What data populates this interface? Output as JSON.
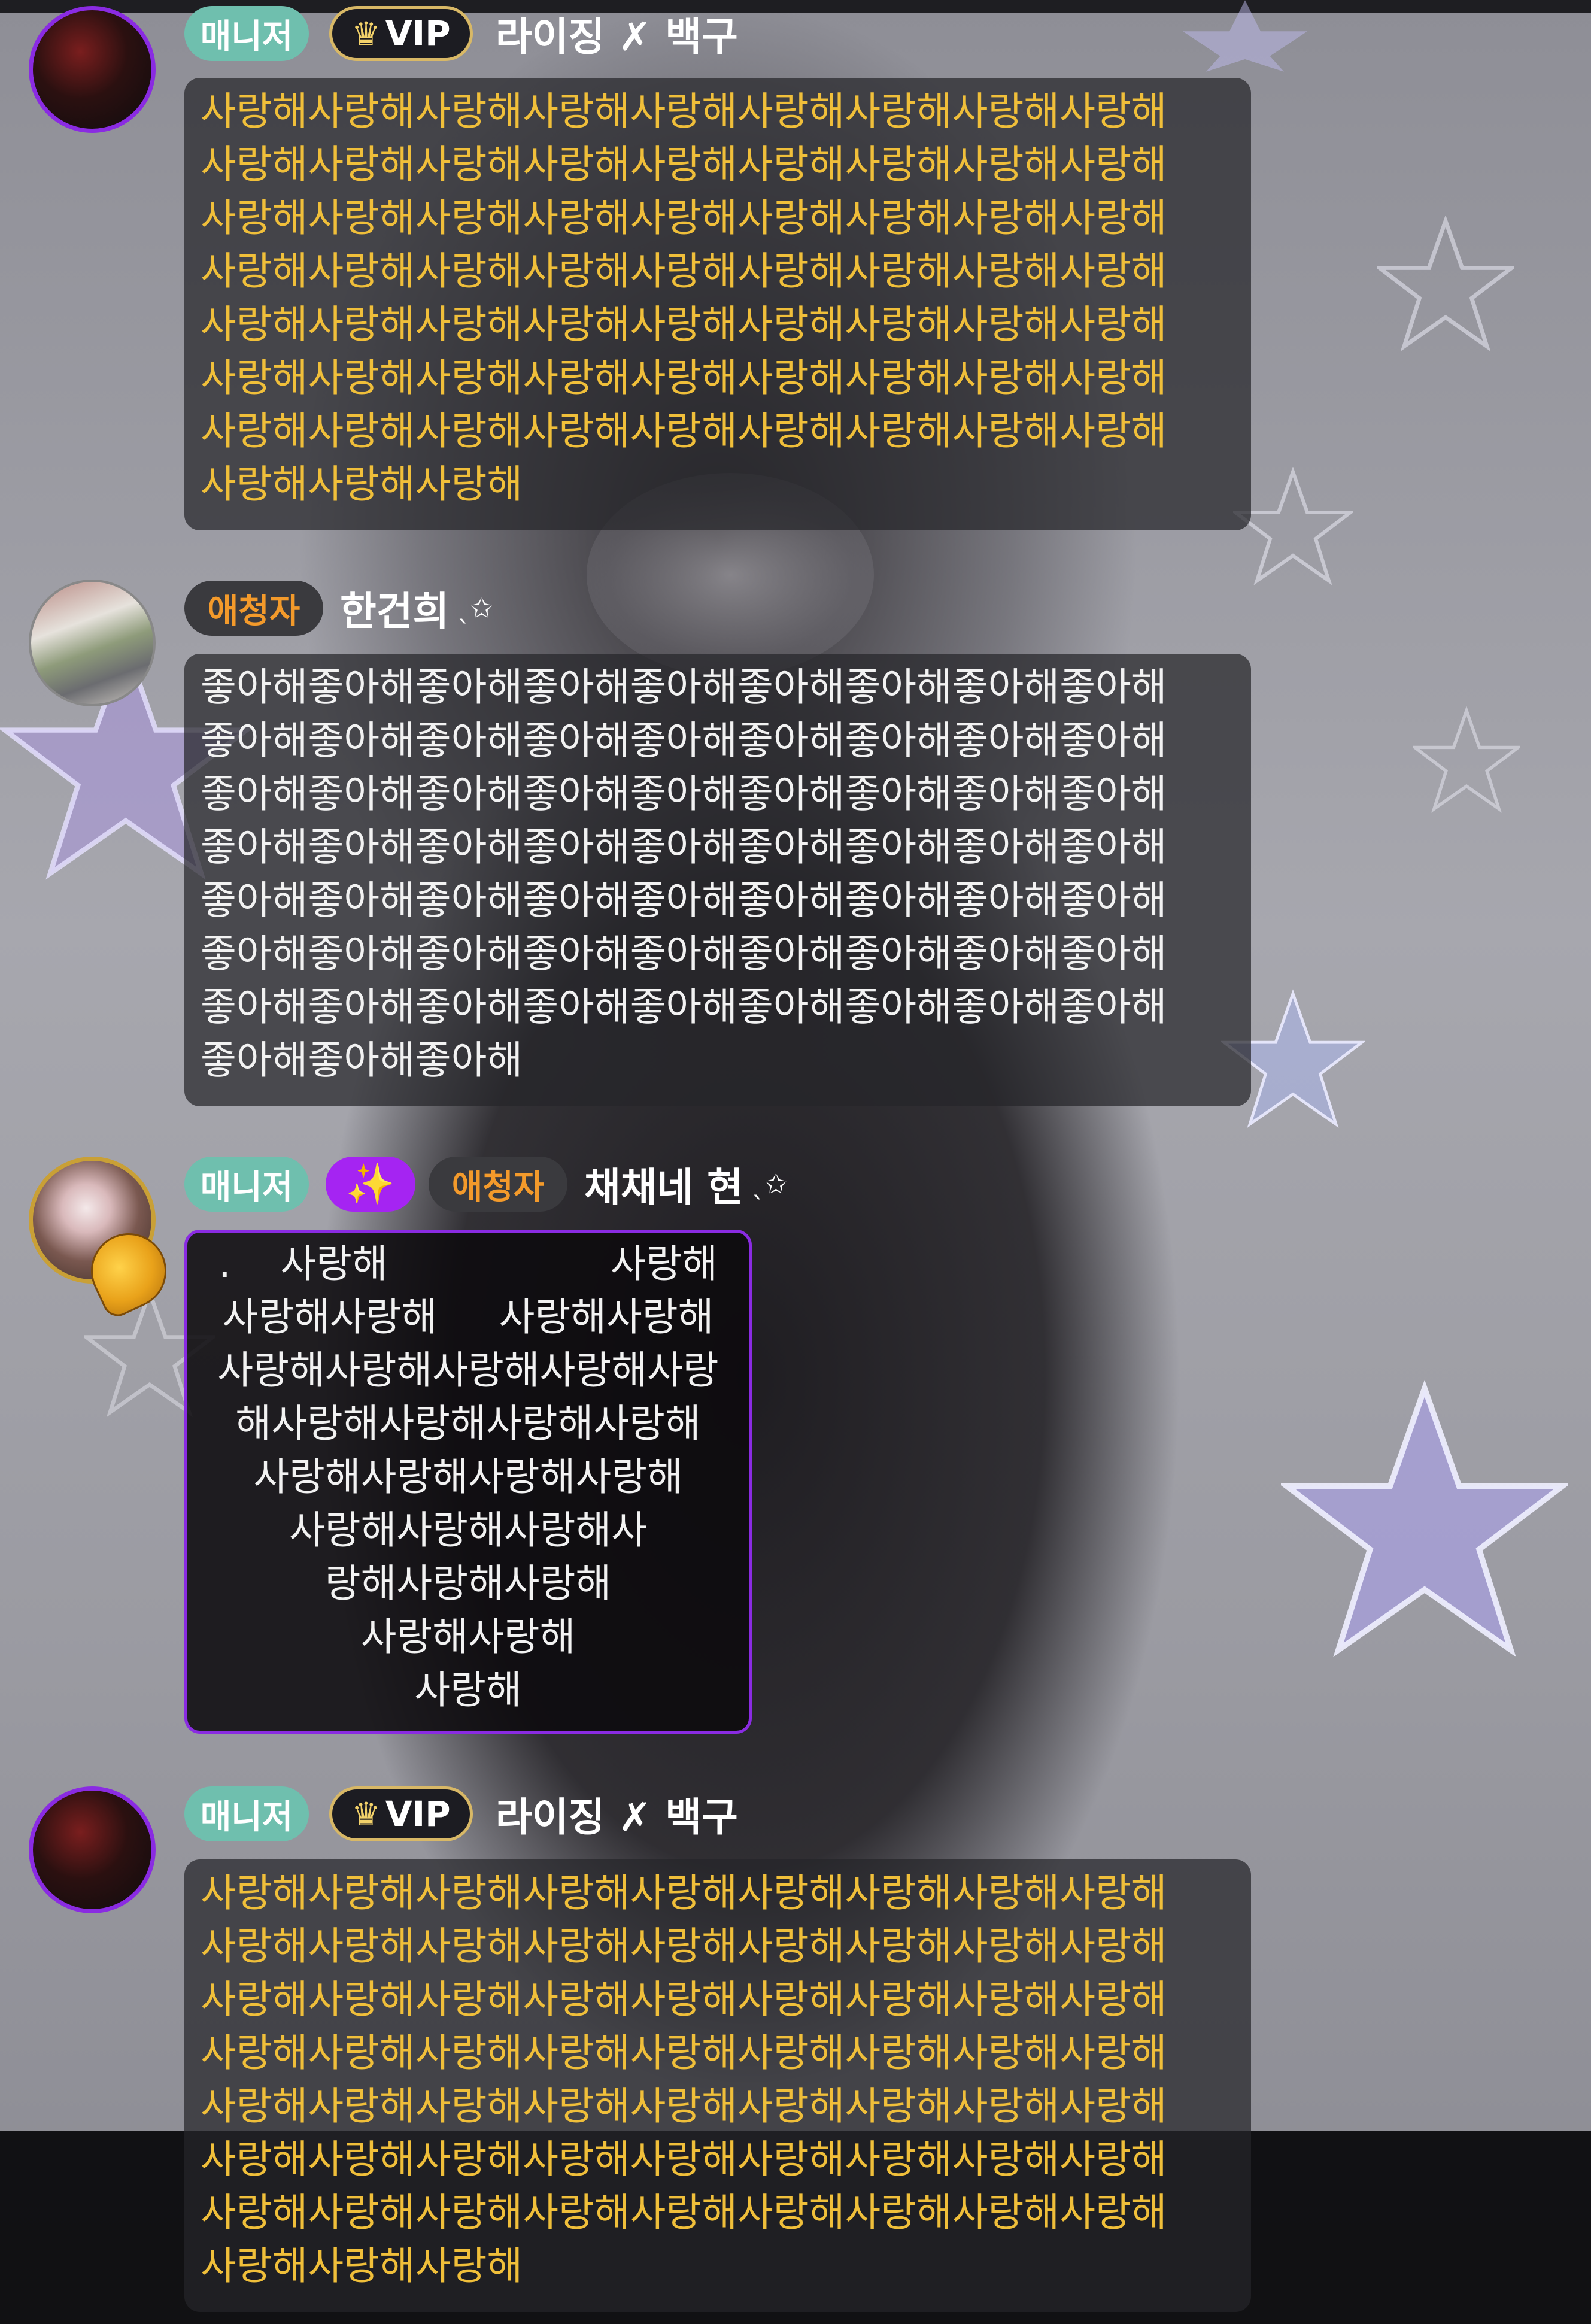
{
  "messages": [
    {
      "badges": [
        "매니저",
        "VIP"
      ],
      "username": "라이징 ✗ 백구",
      "name_suffix": "",
      "lines": [
        "사랑해사랑해사랑해사랑해사랑해사랑해사랑해사랑해사랑해",
        "사랑해사랑해사랑해사랑해사랑해사랑해사랑해사랑해사랑해",
        "사랑해사랑해사랑해사랑해사랑해사랑해사랑해사랑해사랑해",
        "사랑해사랑해사랑해사랑해사랑해사랑해사랑해사랑해사랑해",
        "사랑해사랑해사랑해사랑해사랑해사랑해사랑해사랑해사랑해",
        "사랑해사랑해사랑해사랑해사랑해사랑해사랑해사랑해사랑해",
        "사랑해사랑해사랑해사랑해사랑해사랑해사랑해사랑해사랑해",
        "사랑해사랑해사랑해"
      ]
    },
    {
      "badges": [
        "애청자"
      ],
      "username": "한건희",
      "name_suffix": "ˎ✩",
      "lines": [
        "좋아해좋아해좋아해좋아해좋아해좋아해좋아해좋아해좋아해",
        "좋아해좋아해좋아해좋아해좋아해좋아해좋아해좋아해좋아해",
        "좋아해좋아해좋아해좋아해좋아해좋아해좋아해좋아해좋아해",
        "좋아해좋아해좋아해좋아해좋아해좋아해좋아해좋아해좋아해",
        "좋아해좋아해좋아해좋아해좋아해좋아해좋아해좋아해좋아해",
        "좋아해좋아해좋아해좋아해좋아해좋아해좋아해좋아해좋아해",
        "좋아해좋아해좋아해좋아해좋아해좋아해좋아해좋아해좋아해",
        "좋아해좋아해좋아해"
      ]
    },
    {
      "badges": [
        "매니저",
        "✨",
        "애청자"
      ],
      "username": "채채네 현",
      "name_suffix": "ˎ✩",
      "lines": [
        ".    사랑해                  사랑해",
        "사랑해사랑해     사랑해사랑해",
        "사랑해사랑해사랑해사랑해사랑",
        "해사랑해사랑해사랑해사랑해",
        "사랑해사랑해사랑해사랑해",
        "사랑해사랑해사랑해사",
        "랑해사랑해사랑해",
        "사랑해사랑해",
        "사랑해"
      ]
    },
    {
      "badges": [
        "매니저",
        "VIP"
      ],
      "username": "라이징 ✗ 백구",
      "name_suffix": "",
      "lines": [
        "사랑해사랑해사랑해사랑해사랑해사랑해사랑해사랑해사랑해",
        "사랑해사랑해사랑해사랑해사랑해사랑해사랑해사랑해사랑해",
        "사랑해사랑해사랑해사랑해사랑해사랑해사랑해사랑해사랑해",
        "사랑해사랑해사랑해사랑해사랑해사랑해사랑해사랑해사랑해",
        "사랑해사랑해사랑해사랑해사랑해사랑해사랑해사랑해사랑해",
        "사랑해사랑해사랑해사랑해사랑해사랑해사랑해사랑해사랑해",
        "사랑해사랑해사랑해사랑해사랑해사랑해사랑해사랑해사랑해",
        "사랑해사랑해사랑해"
      ]
    }
  ],
  "colors": {
    "manager_badge": "#6fbfae",
    "viewer_badge_text": "#f39a2b",
    "vip_border": "#d8b866",
    "sparkle_badge": "#a524f2",
    "vip_message_text": "#f0bf3a",
    "avatar_ring": "#8a2be2"
  },
  "icons": {
    "vip_badge": "crown-icon",
    "sparkle_badge": "sparkles-icon"
  }
}
